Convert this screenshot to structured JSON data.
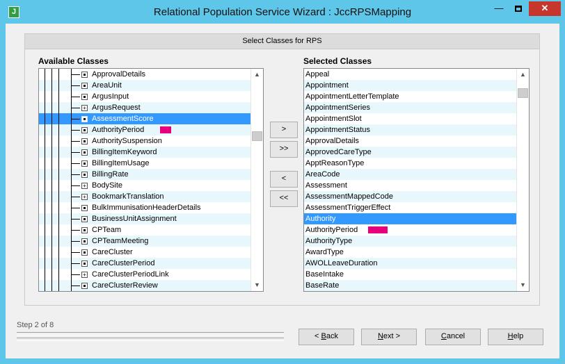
{
  "window": {
    "app_icon": "J",
    "title": "Relational Population Service Wizard  :  JccRPSMapping",
    "min_glyph": "—",
    "close_glyph": "✕"
  },
  "wizard": {
    "section_title": "Select Classes for RPS",
    "available_label": "Available Classes",
    "selected_label": "Selected Classes",
    "step": "Step 2 of 8"
  },
  "colors": {
    "highlight": "#3399ff",
    "row_alt": "#e8f7fb",
    "marker": "#e6007e",
    "titlebar": "#5ec6e9",
    "close": "#c7362c"
  },
  "available_classes": [
    {
      "label": "ApprovalDetails",
      "node": "leaf"
    },
    {
      "label": "AreaUnit",
      "node": "leaf"
    },
    {
      "label": "ArgusInput",
      "node": "leaf"
    },
    {
      "label": "ArgusRequest",
      "node": "expand"
    },
    {
      "label": "AssessmentScore",
      "node": "leaf",
      "selected": true
    },
    {
      "label": "AuthorityPeriod",
      "node": "leaf",
      "marker": true
    },
    {
      "label": "AuthoritySuspension",
      "node": "leaf"
    },
    {
      "label": "BillingItemKeyword",
      "node": "leaf"
    },
    {
      "label": "BillingItemUsage",
      "node": "leaf"
    },
    {
      "label": "BillingRate",
      "node": "leaf"
    },
    {
      "label": "BodySite",
      "node": "expand"
    },
    {
      "label": "BookmarkTranslation",
      "node": "expand"
    },
    {
      "label": "BulkImmunisationHeaderDetails",
      "node": "leaf"
    },
    {
      "label": "BusinessUnitAssignment",
      "node": "leaf"
    },
    {
      "label": "CPTeam",
      "node": "leaf"
    },
    {
      "label": "CPTeamMeeting",
      "node": "leaf"
    },
    {
      "label": "CareCluster",
      "node": "leaf"
    },
    {
      "label": "CareClusterPeriod",
      "node": "leaf"
    },
    {
      "label": "CareClusterPeriodLink",
      "node": "expand"
    },
    {
      "label": "CareClusterReview",
      "node": "leaf"
    }
  ],
  "selected_classes": [
    {
      "label": "Appeal"
    },
    {
      "label": "Appointment"
    },
    {
      "label": "AppointmentLetterTemplate"
    },
    {
      "label": "AppointmentSeries"
    },
    {
      "label": "AppointmentSlot"
    },
    {
      "label": "AppointmentStatus"
    },
    {
      "label": "ApprovalDetails"
    },
    {
      "label": "ApprovedCareType"
    },
    {
      "label": "ApptReasonType"
    },
    {
      "label": "AreaCode"
    },
    {
      "label": "Assessment"
    },
    {
      "label": "AssessmentMappedCode"
    },
    {
      "label": "AssessmentTriggerEffect"
    },
    {
      "label": "Authority",
      "selected": true
    },
    {
      "label": "AuthorityPeriod",
      "marker": true
    },
    {
      "label": "AuthorityType"
    },
    {
      "label": "AwardType"
    },
    {
      "label": "AWOLLeaveDuration"
    },
    {
      "label": "BaseIntake"
    },
    {
      "label": "BaseRate"
    }
  ],
  "scroll": {
    "available_position": 0.27,
    "selected_position": 0.04
  },
  "move_buttons": {
    "add": ">",
    "add_all": ">>",
    "remove": "<",
    "remove_all": "<<"
  },
  "nav": {
    "back": {
      "accel": "B",
      "rest": "ack",
      "prefix": "< "
    },
    "next": {
      "accel": "N",
      "rest": "ext >"
    },
    "cancel": {
      "accel": "C",
      "rest": "ancel"
    },
    "help": {
      "accel": "H",
      "rest": "elp"
    }
  },
  "icons": {
    "scroll_up": "▲",
    "scroll_down": "▼",
    "expand": "+"
  }
}
